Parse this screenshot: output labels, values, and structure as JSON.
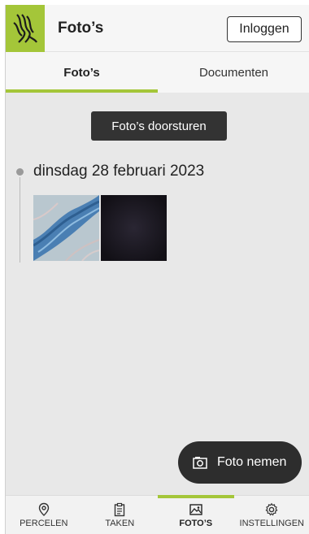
{
  "header": {
    "title": "Foto’s",
    "login_label": "Inloggen",
    "logo_icon": "flemish-lion-logo",
    "brand_color": "#a4c639"
  },
  "tabs": [
    {
      "label": "Foto’s",
      "active": true
    },
    {
      "label": "Documenten",
      "active": false
    }
  ],
  "content": {
    "forward_label": "Foto’s doorsturen",
    "groups": [
      {
        "date": "dinsdag 28 februari 2023",
        "photo_count": 2
      }
    ]
  },
  "fab": {
    "label": "Foto nemen",
    "icon": "camera-icon"
  },
  "bottom_nav": [
    {
      "label": "PERCELEN",
      "icon": "map-pin-icon",
      "active": false
    },
    {
      "label": "TAKEN",
      "icon": "clipboard-icon",
      "active": false
    },
    {
      "label": "FOTO’S",
      "icon": "photos-icon",
      "active": true
    },
    {
      "label": "INSTELLINGEN",
      "icon": "gear-icon",
      "active": false
    }
  ]
}
